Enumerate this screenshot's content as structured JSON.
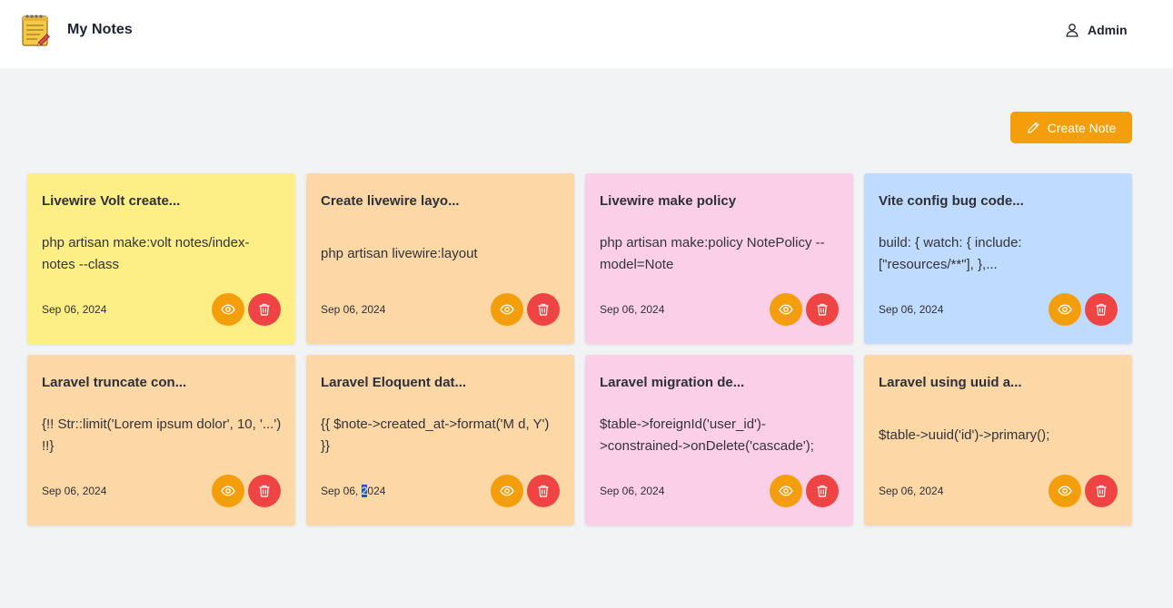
{
  "app": {
    "title": "My Notes",
    "user": "Admin",
    "logo_icon": "notepad-icon",
    "user_icon": "user-icon"
  },
  "actions": {
    "create_label": "Create Note",
    "create_icon": "pencil-icon"
  },
  "colors": {
    "accent": "#f59e0b",
    "danger": "#ef4444",
    "background": "#f2f3f5",
    "card_yellow": "#fdef86",
    "card_orange": "#fdd8a7",
    "card_pink": "#fbcfe8",
    "card_blue": "#bfdbfe"
  },
  "notes": [
    {
      "title": "Livewire Volt create...",
      "body": "php artisan make:volt notes/index-notes --class",
      "date": "Sep 06, 2024",
      "color": "yellow"
    },
    {
      "title": "Create livewire layo...",
      "body": "php artisan livewire:layout",
      "date": "Sep 06, 2024",
      "color": "orange"
    },
    {
      "title": "Livewire make policy",
      "body": "php artisan make:policy NotePolicy --model=Note",
      "date": "Sep 06, 2024",
      "color": "pink"
    },
    {
      "title": "Vite config bug code...",
      "body": "build: { watch: { include: [\"resources/**\"], },...",
      "date": "Sep 06, 2024",
      "color": "blue"
    },
    {
      "title": "Laravel truncate con...",
      "body": "{!! Str::limit('Lorem ipsum dolor', 10, '...') !!}",
      "date": "Sep 06, 2024",
      "color": "orange"
    },
    {
      "title": "Laravel Eloquent dat...",
      "body": "{{ $note->created_at->format('M d, Y') }}",
      "date": "Sep 06, 2024",
      "date_parts": [
        "Sep 06, ",
        "2",
        "024"
      ],
      "color": "orange"
    },
    {
      "title": "Laravel migration de...",
      "body": "$table->foreignId('user_id')->constrained->onDelete('cascade');",
      "date": "Sep 06, 2024",
      "color": "pink"
    },
    {
      "title": "Laravel using uuid a...",
      "body": "$table->uuid('id')->primary();",
      "date": "Sep 06, 2024",
      "color": "orange"
    }
  ],
  "card_actions": {
    "view_icon": "eye-icon",
    "delete_icon": "trash-icon"
  }
}
